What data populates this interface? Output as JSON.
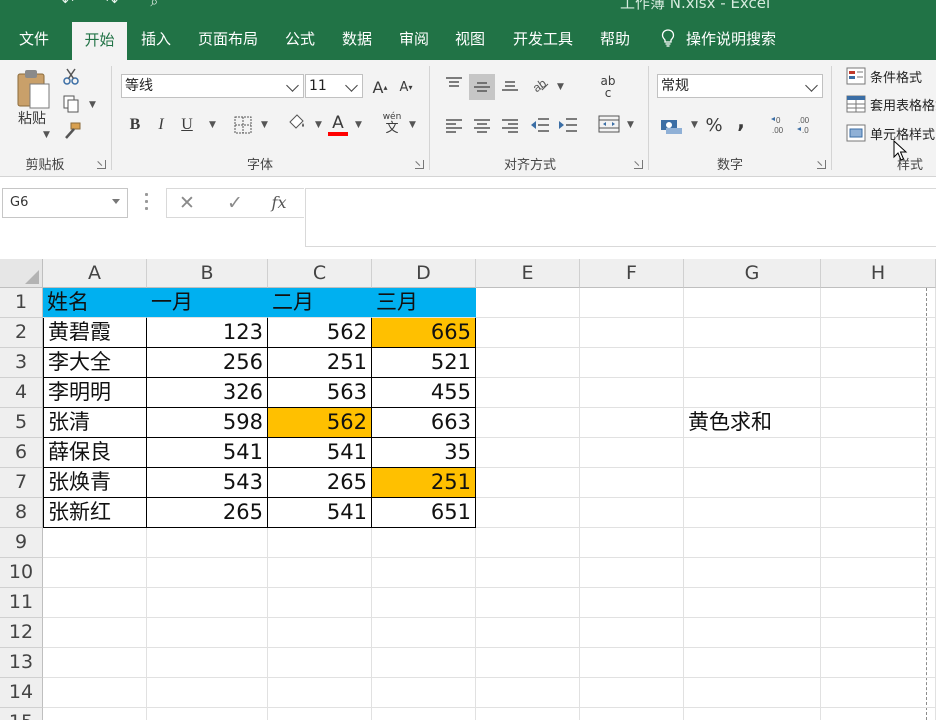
{
  "title_strip": {
    "window_title": "工作簿 N.xlsx - Excel",
    "qat_glyphs": "↶ ↷ ⌕"
  },
  "tabs": [
    {
      "label": "文件"
    },
    {
      "label": "开始"
    },
    {
      "label": "插入"
    },
    {
      "label": "页面布局"
    },
    {
      "label": "公式"
    },
    {
      "label": "数据"
    },
    {
      "label": "审阅"
    },
    {
      "label": "视图"
    },
    {
      "label": "开发工具"
    },
    {
      "label": "帮助"
    }
  ],
  "tellme": {
    "label": "操作说明搜索",
    "icon": "lightbulb-icon"
  },
  "ribbon": {
    "clipboard": {
      "group_label": "剪贴板",
      "paste_label": "粘贴"
    },
    "font": {
      "group_label": "字体",
      "font_name": "等线",
      "font_size": "11",
      "grow_label": "A",
      "shrink_label": "A",
      "bold_label": "B",
      "italic_label": "I",
      "underline_label": "U",
      "font_color_label": "A",
      "phonetic_top": "wén",
      "phonetic_bottom": "文",
      "font_color": "#ff0000"
    },
    "alignment": {
      "group_label": "对齐方式",
      "wrap_top": "ab",
      "wrap_bottom": "c"
    },
    "number": {
      "group_label": "数字",
      "format": "常规",
      "percent_label": "%",
      "comma_label": ","
    },
    "styles": {
      "group_label": "样式",
      "conditional_format": "条件格式",
      "table_format": "套用表格格式",
      "cell_styles": "单元格样式"
    }
  },
  "formula_bar": {
    "name_box": "G6",
    "cancel": "✕",
    "enter": "✓",
    "fx": "fx",
    "content": ""
  },
  "sheet": {
    "columns": [
      "A",
      "B",
      "C",
      "D",
      "E",
      "F",
      "G",
      "H"
    ],
    "rows": [
      "1",
      "2",
      "3",
      "4",
      "5",
      "6",
      "7",
      "8",
      "9",
      "10",
      "11",
      "12",
      "13",
      "14",
      "15"
    ],
    "header_row": [
      "姓名",
      "一月",
      "二月",
      "三月"
    ],
    "data": [
      [
        "黄碧霞",
        "123",
        "562",
        "665"
      ],
      [
        "李大全",
        "256",
        "251",
        "521"
      ],
      [
        "李明明",
        "326",
        "563",
        "455"
      ],
      [
        "张清",
        "598",
        "562",
        "663"
      ],
      [
        "薛保良",
        "541",
        "541",
        "35"
      ],
      [
        "张焕青",
        "543",
        "265",
        "251"
      ],
      [
        "张新红",
        "265",
        "541",
        "651"
      ]
    ],
    "highlighted_cells": [
      "D2",
      "C5",
      "D7"
    ],
    "header_fill": "#00b0f0",
    "highlight_fill": "#ffc000",
    "label_g5": "黄色求和"
  }
}
